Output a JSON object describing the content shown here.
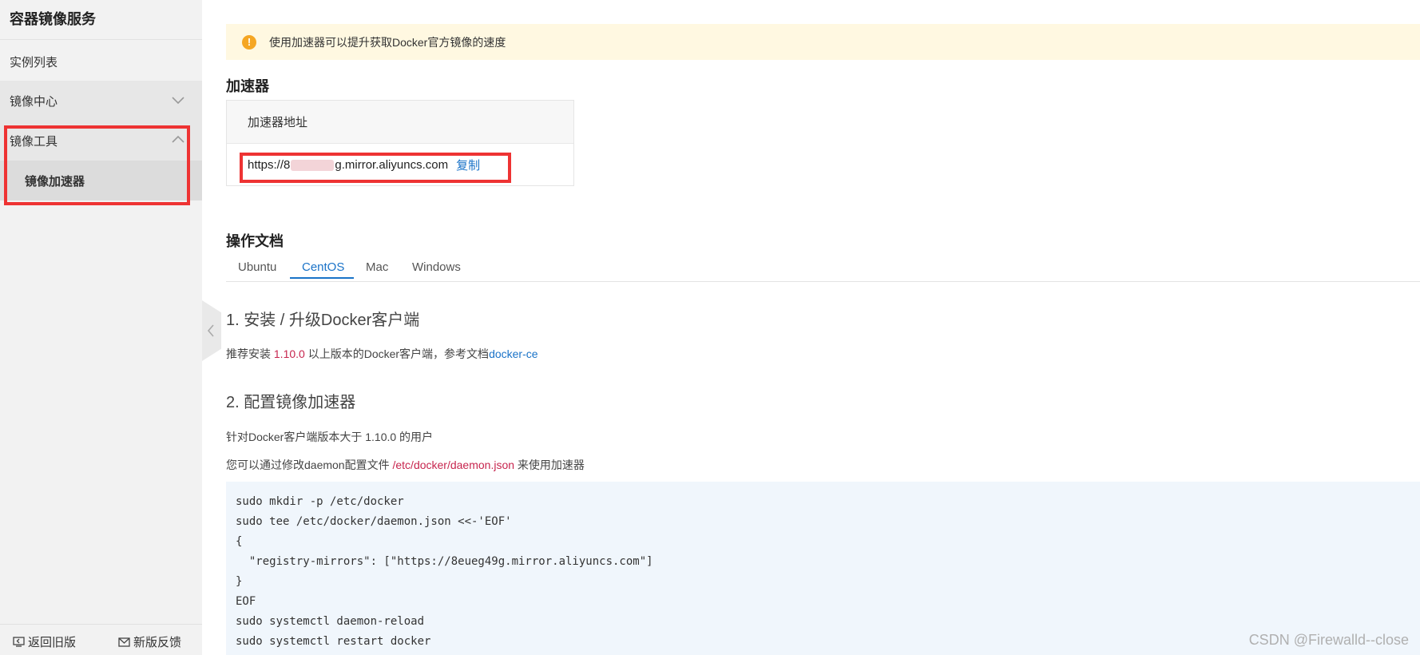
{
  "sidebar": {
    "title": "容器镜像服务",
    "items": [
      {
        "label": "实例列表"
      },
      {
        "label": "镜像中心"
      },
      {
        "label": "镜像工具"
      },
      {
        "label": "镜像加速器"
      }
    ],
    "footer": {
      "back_label": "返回旧版",
      "feedback_label": "新版反馈"
    }
  },
  "notice": {
    "text": "使用加速器可以提升获取Docker官方镜像的速度"
  },
  "accelerator": {
    "heading": "加速器",
    "table_header": "加速器地址",
    "url_prefix": "https://8",
    "url_suffix": "g.mirror.aliyuncs.com",
    "copy_label": "复制"
  },
  "docs": {
    "heading": "操作文档",
    "tabs": [
      "Ubuntu",
      "CentOS",
      "Mac",
      "Windows"
    ],
    "active_tab": "CentOS",
    "step1": {
      "heading": "1. 安装 / 升级Docker客户端",
      "text_before": "推荐安装 ",
      "version": "1.10.0",
      "text_middle": " 以上版本的Docker客户端，参考文档",
      "link": "docker-ce"
    },
    "step2": {
      "heading": "2. 配置镜像加速器",
      "line1": "针对Docker客户端版本大于 1.10.0 的用户",
      "line2_before": "您可以通过修改daemon配置文件 ",
      "line2_path": "/etc/docker/daemon.json",
      "line2_after": " 来使用加速器"
    },
    "code": [
      "sudo mkdir -p /etc/docker",
      "sudo tee /etc/docker/daemon.json <<-'EOF'",
      "{",
      "  \"registry-mirrors\": [\"https://8eueg49g.mirror.aliyuncs.com\"]",
      "}",
      "EOF",
      "sudo systemctl daemon-reload",
      "sudo systemctl restart docker"
    ]
  },
  "watermark": "CSDN @Firewalld--close",
  "colors": {
    "accent": "#1a73c8",
    "highlight_box": "#ee3333",
    "notice_bg": "#fff8e1",
    "code_bg": "#f0f6fc"
  }
}
